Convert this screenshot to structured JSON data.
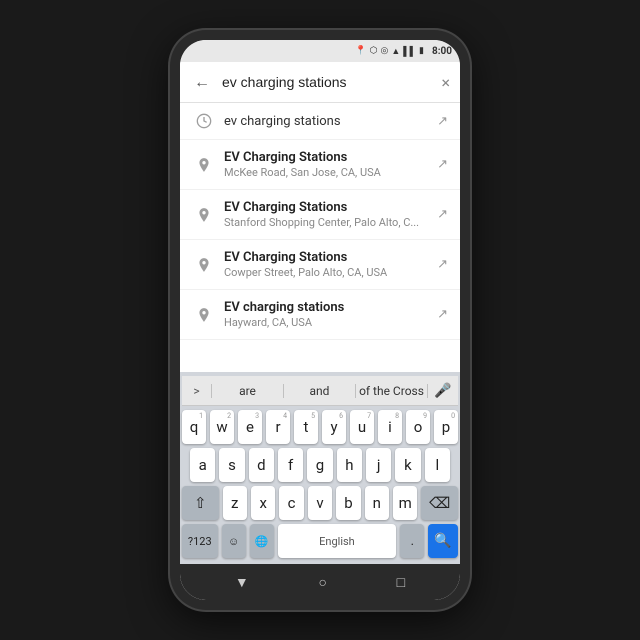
{
  "statusBar": {
    "time": "8:00",
    "icons": [
      "location",
      "bluetooth",
      "circle",
      "wifi",
      "signal",
      "battery"
    ]
  },
  "searchBar": {
    "backLabel": "←",
    "searchValue": "ev charging stations",
    "clearLabel": "×"
  },
  "suggestions": [
    {
      "type": "history",
      "title": "ev charging stations",
      "subtitle": "",
      "bold": false
    },
    {
      "type": "place",
      "title": "EV Charging Stations",
      "subtitle": "McKee Road, San Jose, CA, USA",
      "bold": true
    },
    {
      "type": "place",
      "title": "EV Charging Stations",
      "subtitle": "Stanford Shopping Center, Palo Alto, C...",
      "bold": true
    },
    {
      "type": "place",
      "title": "EV Charging Stations",
      "subtitle": "Cowper Street, Palo Alto, CA, USA",
      "bold": true
    },
    {
      "type": "place",
      "title": "EV charging stations",
      "subtitle": "Hayward, CA, USA",
      "bold": true
    }
  ],
  "keyboard": {
    "suggestions": [
      "are",
      "and",
      "of the Cross"
    ],
    "rows": [
      [
        "q",
        "w",
        "e",
        "r",
        "t",
        "y",
        "u",
        "i",
        "o",
        "p"
      ],
      [
        "a",
        "s",
        "d",
        "f",
        "g",
        "h",
        "j",
        "k",
        "l"
      ],
      [
        "z",
        "x",
        "c",
        "v",
        "b",
        "n",
        "m"
      ]
    ],
    "nums": [
      "1",
      "2",
      "3",
      "4",
      "5",
      "6",
      "7",
      "8",
      "9",
      "0"
    ],
    "bottomLeft": "?123",
    "space": "English",
    "bottomRight": ".",
    "actionIcon": "🔍"
  },
  "bottomNav": {
    "backIcon": "▼",
    "homeIcon": "○",
    "recentIcon": "□"
  }
}
